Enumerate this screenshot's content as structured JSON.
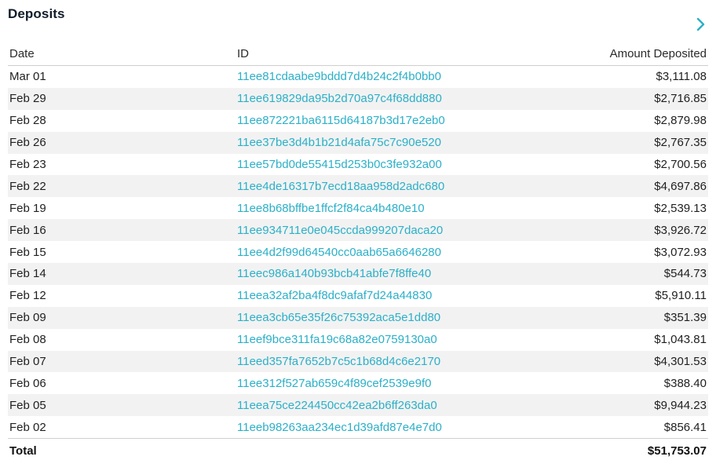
{
  "widget": {
    "title": "Deposits",
    "accent_color": "#2bb0c8",
    "expand_icon": "chevron-right-icon"
  },
  "table": {
    "columns": [
      "Date",
      "ID",
      "Amount Deposited"
    ],
    "rows": [
      {
        "date": "Mar 01",
        "id": "11ee81cdaabe9bddd7d4b24c2f4b0bb0",
        "amount": "$3,111.08"
      },
      {
        "date": "Feb 29",
        "id": "11ee619829da95b2d70a97c4f68dd880",
        "amount": "$2,716.85"
      },
      {
        "date": "Feb 28",
        "id": "11ee872221ba6115d64187b3d17e2eb0",
        "amount": "$2,879.98"
      },
      {
        "date": "Feb 26",
        "id": "11ee37be3d4b1b21d4afa75c7c90e520",
        "amount": "$2,767.35"
      },
      {
        "date": "Feb 23",
        "id": "11ee57bd0de55415d253b0c3fe932a00",
        "amount": "$2,700.56"
      },
      {
        "date": "Feb 22",
        "id": "11ee4de16317b7ecd18aa958d2adc680",
        "amount": "$4,697.86"
      },
      {
        "date": "Feb 19",
        "id": "11ee8b68bffbe1ffcf2f84ca4b480e10",
        "amount": "$2,539.13"
      },
      {
        "date": "Feb 16",
        "id": "11ee934711e0e045ccda999207daca20",
        "amount": "$3,926.72"
      },
      {
        "date": "Feb 15",
        "id": "11ee4d2f99d64540cc0aab65a6646280",
        "amount": "$3,072.93"
      },
      {
        "date": "Feb 14",
        "id": "11eec986a140b93bcb41abfe7f8ffe40",
        "amount": "$544.73"
      },
      {
        "date": "Feb 12",
        "id": "11eea32af2ba4f8dc9afaf7d24a44830",
        "amount": "$5,910.11"
      },
      {
        "date": "Feb 09",
        "id": "11eea3cb65e35f26c75392aca5e1dd80",
        "amount": "$351.39"
      },
      {
        "date": "Feb 08",
        "id": "11eef9bce311fa19c68a82e0759130a0",
        "amount": "$1,043.81"
      },
      {
        "date": "Feb 07",
        "id": "11eed357fa7652b7c5c1b68d4c6e2170",
        "amount": "$4,301.53"
      },
      {
        "date": "Feb 06",
        "id": "11ee312f527ab659c4f89cef2539e9f0",
        "amount": "$388.40"
      },
      {
        "date": "Feb 05",
        "id": "11eea75ce224450cc42ea2b6ff263da0",
        "amount": "$9,944.23"
      },
      {
        "date": "Feb 02",
        "id": "11eeb98263aa234ec1d39afd87e4e7d0",
        "amount": "$856.41"
      }
    ],
    "total": {
      "label": "Total",
      "amount": "$51,753.07"
    }
  }
}
